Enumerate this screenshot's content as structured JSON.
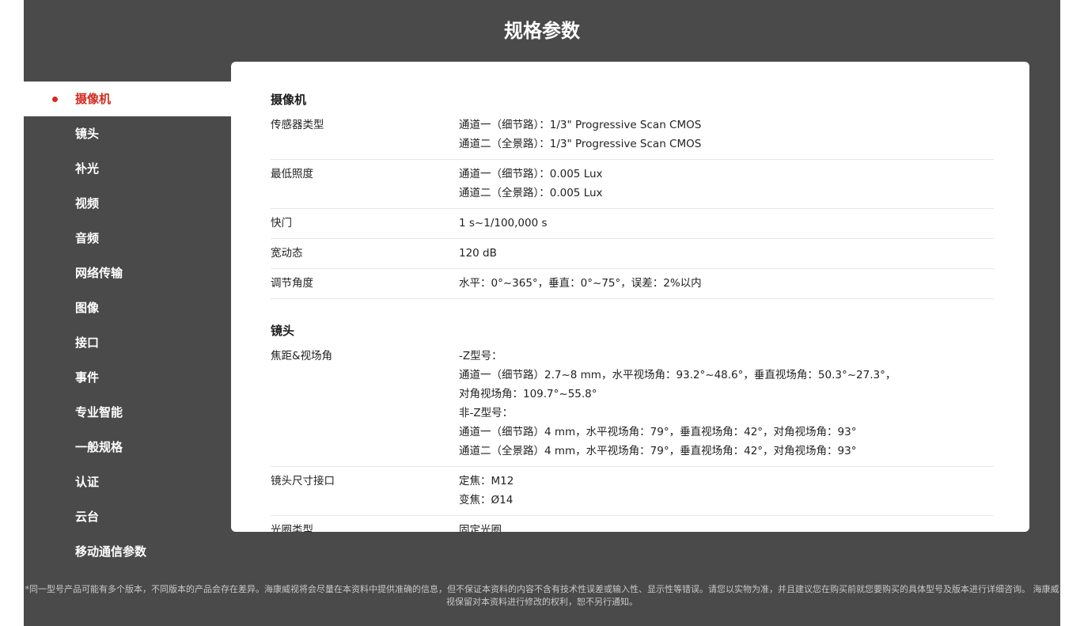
{
  "page": {
    "title": "规格参数",
    "footer": "*同一型号产品可能有多个版本，不同版本的产品会存在差异。海康威视将会尽量在本资料中提供准确的信息，但不保证本资料的内容不含有技术性误差或输入性、显示性等错误。请您以实物为准，并且建议您在购买前就您要购买的具体型号及版本进行详细咨询。 海康威视保留对本资料进行修改的权利，恕不另行通知。"
  },
  "colors": {
    "accent": "#d52b1e",
    "panel": "#4a4a4a"
  },
  "sidebar": {
    "items": [
      {
        "label": "摄像机",
        "active": true
      },
      {
        "label": "镜头"
      },
      {
        "label": "补光"
      },
      {
        "label": "视频"
      },
      {
        "label": "音频"
      },
      {
        "label": "网络传输"
      },
      {
        "label": "图像"
      },
      {
        "label": "接口"
      },
      {
        "label": "事件"
      },
      {
        "label": "专业智能"
      },
      {
        "label": "一般规格"
      },
      {
        "label": "认证"
      },
      {
        "label": "云台"
      },
      {
        "label": "移动通信参数"
      }
    ]
  },
  "sections": [
    {
      "title": "摄像机",
      "rows": [
        {
          "label": "传感器类型",
          "values": [
            "通道一（细节路）：1/3\" Progressive Scan CMOS",
            "通道二（全景路）：1/3\" Progressive Scan CMOS"
          ]
        },
        {
          "label": "最低照度",
          "values": [
            "通道一（细节路）：0.005 Lux",
            "通道二（全景路）：0.005 Lux"
          ]
        },
        {
          "label": "快门",
          "values": [
            "1 s~1/100,000 s"
          ]
        },
        {
          "label": "宽动态",
          "values": [
            "120 dB"
          ]
        },
        {
          "label": "调节角度",
          "values": [
            "水平：0°~365°，垂直：0°~75°，误差：2%以内"
          ]
        }
      ]
    },
    {
      "title": "镜头",
      "rows": [
        {
          "label": "焦距&视场角",
          "values": [
            "-Z型号：",
            "通道一（细节路）2.7~8 mm，水平视场角：93.2°~48.6°，垂直视场角：50.3°~27.3°，",
            "对角视场角：109.7°~55.8°",
            "非-Z型号：",
            "通道一（细节路）4 mm，水平视场角：79°，垂直视场角：42°，对角视场角：93°",
            "通道二（全景路）4 mm，水平视场角：79°，垂直视场角：42°，对角视场角：93°"
          ]
        },
        {
          "label": "镜头尺寸接口",
          "values": [
            "定焦：M12",
            "变焦：Ø14"
          ]
        },
        {
          "label": "光圈类型",
          "values": [
            "固定光圈"
          ]
        }
      ]
    }
  ]
}
